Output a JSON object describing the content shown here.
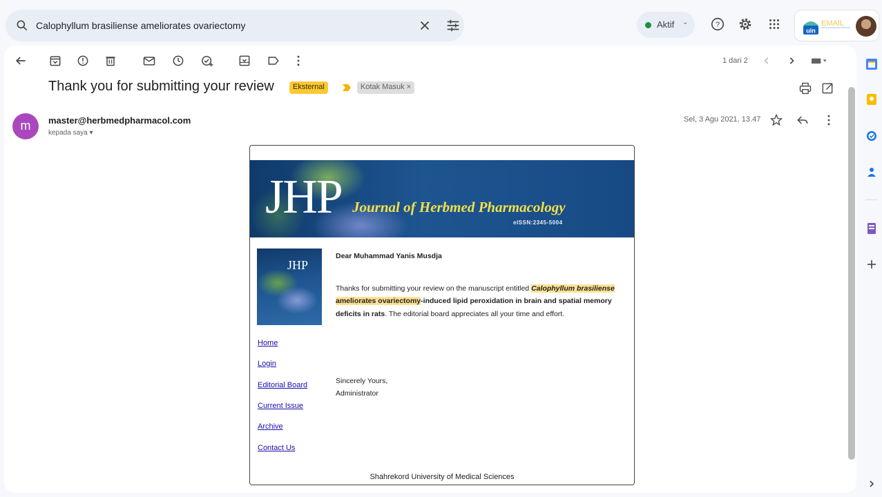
{
  "search": {
    "query": "Calophyllum brasiliense ameliorates ovariectomy"
  },
  "status": {
    "label": "Aktif"
  },
  "account": {
    "logo_text": "EMAIL",
    "logo_badge": "uin"
  },
  "toolbar": {
    "page_count": "1 dari 2"
  },
  "email": {
    "subject": "Thank you for submitting your review",
    "labels": [
      "Eksternal",
      "Kotak Masuk"
    ],
    "sender_initial": "m",
    "sender": "master@herbmedpharmacol.com",
    "recipient": "kepada saya",
    "date": "Sel, 3 Agu 2021, 13.47"
  },
  "content": {
    "banner_abbr": "JHP",
    "journal_name": "Journal of Herbmed Pharmacology",
    "issn": "eISSN:2345-5004",
    "cover_abbr": "JHP",
    "nav": [
      "Home",
      "Login",
      "Editorial Board",
      "Current Issue",
      "Archive",
      "Contact Us"
    ],
    "greeting": "Dear Muhammad Yanis Musdja",
    "para_intro": "Thanks for submitting your review on the manuscript entitled ",
    "title_hl1": "Calophyllum brasiliense",
    "title_mid": " ",
    "title_hl2": "ameliorates ovariectomy",
    "title_rest": "-induced lipid peroxidation in brain and spatial memory deficits in rats",
    "para_end": ". The editorial board appreciates all your time and effort.",
    "sign_1": "Sincerely Yours,",
    "sign_2": "Administrator",
    "footer": "Shahrekord University of Medical Sciences"
  },
  "colors": {
    "accent": "#0b57d0",
    "label_external": "#fcc934",
    "avatar": "#ab47bc",
    "status_dot": "#1e8e3e"
  },
  "icons": [
    "search-icon",
    "close-icon",
    "tune-icon",
    "help-icon",
    "gear-icon",
    "apps-icon",
    "back-icon",
    "archive-icon",
    "report-spam-icon",
    "delete-icon",
    "mark-unread-icon",
    "snooze-icon",
    "add-task-icon",
    "move-to-icon",
    "label-icon",
    "more-vert-icon",
    "prev-icon",
    "next-icon",
    "keyboard-icon",
    "print-icon",
    "open-new-window-icon",
    "star-icon",
    "reply-icon",
    "calendar-icon",
    "keep-icon",
    "tasks-icon",
    "contacts-icon",
    "addon-icon",
    "add-icon",
    "expand-icon"
  ]
}
